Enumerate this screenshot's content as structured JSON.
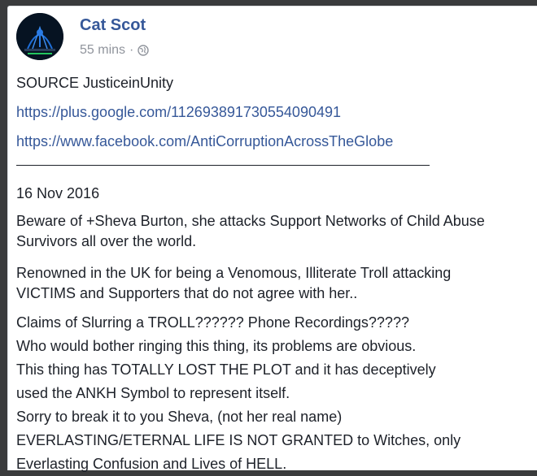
{
  "post": {
    "author": "Cat Scot",
    "time": "55 mins",
    "separator": "·",
    "privacy_icon": "globe-icon",
    "avatar_icon": "profile-avatar-icon",
    "source_line": "SOURCE JusticeinUnity",
    "link1": "https://plus.google.com/112693891730554090491",
    "link2": "https://www.facebook.com/AntiCorruptionAcrossTheGlobe",
    "date": "16 Nov 2016",
    "para1": [
      "Beware of +Sheva Burton, she attacks Support Networks of Child Abuse",
      "Survivors all over the world."
    ],
    "para2": [
      "Renowned in the UK for being a Venomous, Illiterate Troll attacking",
      "VICTIMS and Supporters that do not agree with her.."
    ],
    "para3": [
      "Claims of Slurring a TROLL?????? Phone Recordings?????",
      "Who would bother ringing this thing, its problems are obvious.",
      "This thing has TOTALLY LOST THE PLOT and it has deceptively",
      "used the ANKH Symbol to represent itself.",
      "Sorry to break it to you Sheva, (not her real name)",
      "EVERLASTING/ETERNAL LIFE IS NOT GRANTED to Witches, only",
      "Everlasting Confusion and Lives of HELL."
    ]
  },
  "colors": {
    "link": "#365899",
    "text": "#1d2129",
    "meta": "#90949c",
    "background": "#3a3b3c"
  }
}
